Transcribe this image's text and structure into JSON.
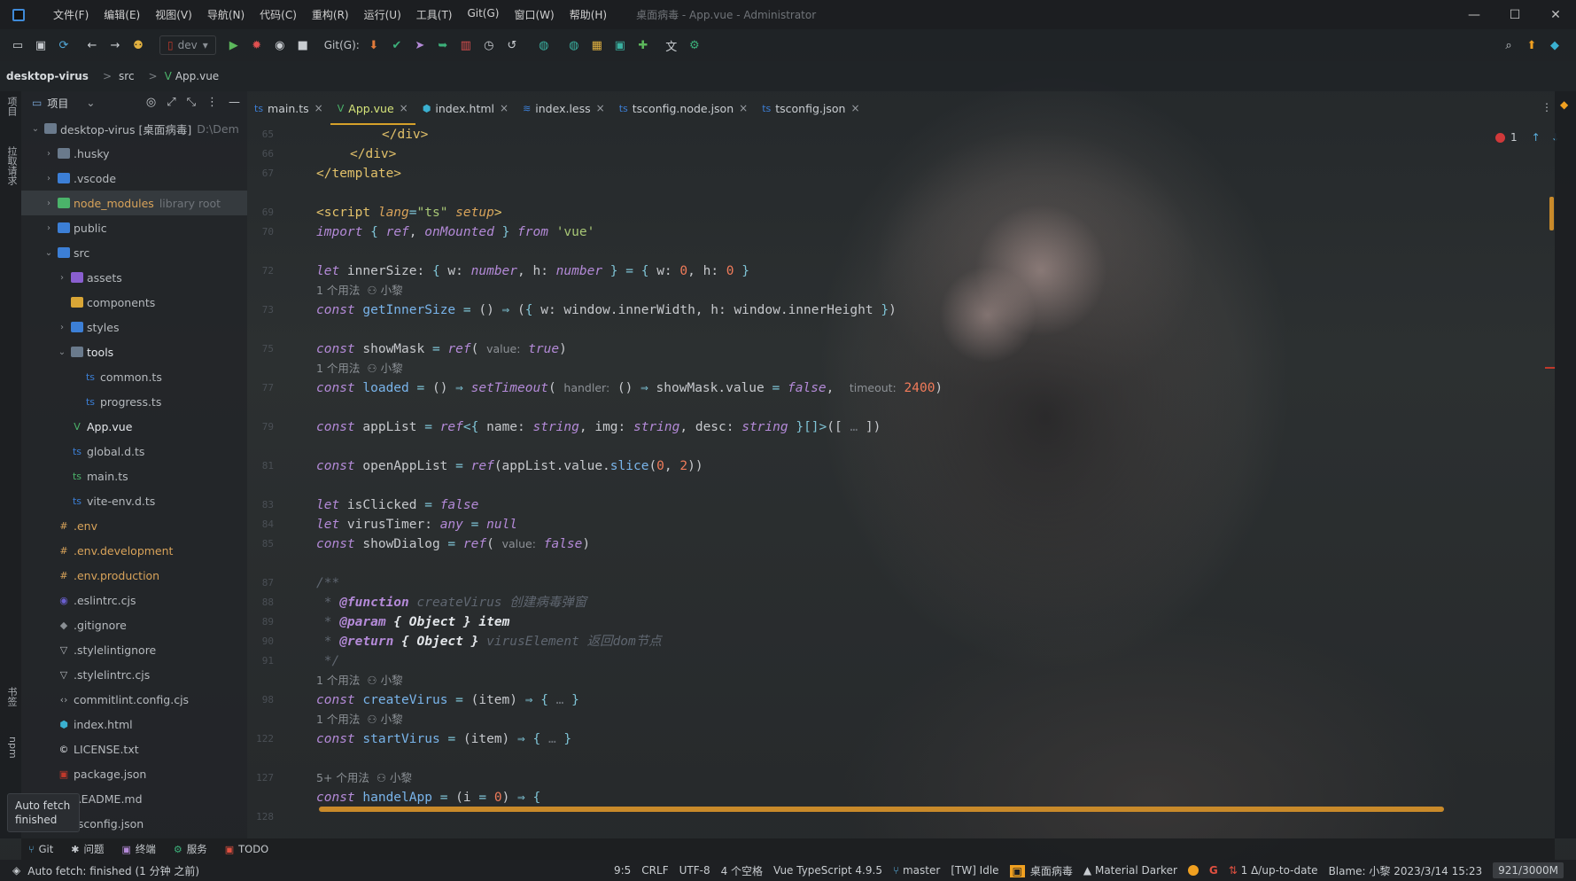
{
  "title_bar": {
    "menus": [
      "文件(F)",
      "编辑(E)",
      "视图(V)",
      "导航(N)",
      "代码(C)",
      "重构(R)",
      "运行(U)",
      "工具(T)",
      "Git(G)",
      "窗口(W)",
      "帮助(H)"
    ],
    "window_title": "桌面病毒 - App.vue - Administrator",
    "minimize": "—",
    "maximize": "☐",
    "close": "✕"
  },
  "toolbar": {
    "branch_config": "dev",
    "git_label": "Git(G):"
  },
  "breadcrumb": {
    "project": "desktop-virus",
    "folder": "src",
    "file": "App.vue",
    "sep": ">"
  },
  "left_stripe": {
    "project": "项目",
    "pull_requests": "拉取请求",
    "bookmarks": "书签",
    "npm": "npm"
  },
  "project_panel": {
    "title": "项目",
    "tree": [
      {
        "label": "desktop-virus [桌面病毒]",
        "hint": "D:\\Dem",
        "depth": 0,
        "chev": "⌄",
        "icon": "folder"
      },
      {
        "label": ".husky",
        "depth": 1,
        "chev": "›",
        "icon": "folder"
      },
      {
        "label": ".vscode",
        "depth": 1,
        "chev": "›",
        "icon": "blue"
      },
      {
        "label": "node_modules",
        "hint": "library root",
        "depth": 1,
        "chev": "›",
        "icon": "green",
        "orange": true,
        "selected": true
      },
      {
        "label": "public",
        "depth": 1,
        "chev": "›",
        "icon": "blue"
      },
      {
        "label": "src",
        "depth": 1,
        "chev": "⌄",
        "icon": "blue"
      },
      {
        "label": "assets",
        "depth": 2,
        "chev": "›",
        "icon": "purple"
      },
      {
        "label": "components",
        "depth": 2,
        "chev": "",
        "icon": "yellow"
      },
      {
        "label": "styles",
        "depth": 2,
        "chev": "›",
        "icon": "blue"
      },
      {
        "label": "tools",
        "depth": 2,
        "chev": "⌄",
        "icon": "folder",
        "white": true
      },
      {
        "label": "common.ts",
        "depth": 3,
        "chev": "",
        "icon": "ts"
      },
      {
        "label": "progress.ts",
        "depth": 3,
        "chev": "",
        "icon": "ts"
      },
      {
        "label": "App.vue",
        "depth": 2,
        "chev": "",
        "icon": "vue",
        "white": true
      },
      {
        "label": "global.d.ts",
        "depth": 2,
        "chev": "",
        "icon": "ts"
      },
      {
        "label": "main.ts",
        "depth": 2,
        "chev": "",
        "icon": "tsg"
      },
      {
        "label": "vite-env.d.ts",
        "depth": 2,
        "chev": "",
        "icon": "ts"
      },
      {
        "label": ".env",
        "depth": 1,
        "chev": "",
        "icon": "env",
        "orange": true
      },
      {
        "label": ".env.development",
        "depth": 1,
        "chev": "",
        "icon": "env",
        "orange": true
      },
      {
        "label": ".env.production",
        "depth": 1,
        "chev": "",
        "icon": "env",
        "orange": true
      },
      {
        "label": ".eslintrc.cjs",
        "depth": 1,
        "chev": "",
        "icon": "eslint"
      },
      {
        "label": ".gitignore",
        "depth": 1,
        "chev": "",
        "icon": "git"
      },
      {
        "label": ".stylelintignore",
        "depth": 1,
        "chev": "",
        "icon": "stylelint"
      },
      {
        "label": ".stylelintrc.cjs",
        "depth": 1,
        "chev": "",
        "icon": "stylelint"
      },
      {
        "label": "commitlint.config.cjs",
        "depth": 1,
        "chev": "",
        "icon": "js"
      },
      {
        "label": "index.html",
        "depth": 1,
        "chev": "",
        "icon": "html"
      },
      {
        "label": "LICENSE.txt",
        "depth": 1,
        "chev": "",
        "icon": "license"
      },
      {
        "label": "package.json",
        "depth": 1,
        "chev": "",
        "icon": "npm"
      },
      {
        "label": "README.md",
        "depth": 1,
        "chev": "",
        "icon": "md"
      },
      {
        "label": "tsconfig.json",
        "depth": 1,
        "chev": "",
        "icon": "ts"
      }
    ]
  },
  "tabs": [
    {
      "label": "main.ts",
      "icon": "ts",
      "active": false
    },
    {
      "label": "App.vue",
      "icon": "vue",
      "active": true
    },
    {
      "label": "index.html",
      "icon": "html",
      "active": false
    },
    {
      "label": "index.less",
      "icon": "less",
      "active": false
    },
    {
      "label": "tsconfig.node.json",
      "icon": "ts",
      "active": false
    },
    {
      "label": "tsconfig.json",
      "icon": "ts",
      "active": false
    }
  ],
  "inspection": {
    "count": "1"
  },
  "editor": {
    "line_numbers": [
      "65",
      "66",
      "67",
      "",
      "69",
      "70",
      "",
      "72",
      "",
      "73",
      "",
      "75",
      "",
      "77",
      "",
      "79",
      "",
      "81",
      "",
      "83",
      "84",
      "85",
      "",
      "87",
      "88",
      "89",
      "90",
      "91",
      "",
      "98",
      "",
      "122",
      "",
      "127",
      "",
      "128"
    ],
    "usage_hint": "1 个用法",
    "usage_hint_many": "5+ 个用法",
    "author": "小黎"
  },
  "toolwindows": [
    {
      "label": "Git",
      "icon": "git"
    },
    {
      "label": "问题",
      "icon": "problems"
    },
    {
      "label": "终端",
      "icon": "terminal"
    },
    {
      "label": "服务",
      "icon": "services"
    },
    {
      "label": "TODO",
      "icon": "todo"
    }
  ],
  "toast": {
    "line1": "Auto fetch",
    "line2": "finished"
  },
  "status_bar": {
    "left": "Auto fetch: finished (1 分钟 之前)",
    "position": "9:5",
    "line_sep": "CRLF",
    "encoding": "UTF-8",
    "indent": "4 个空格",
    "language": "Vue TypeScript 4.9.5",
    "branch": "master",
    "tw": "[TW] Idle",
    "project_name": "桌面病毒",
    "theme": "Material Darker",
    "vcs_status": "1 Δ/up-to-date",
    "blame": "Blame: 小黎 2023/3/14 15:23",
    "memory": "921/3000M"
  },
  "colors": {
    "accent": "#d6a12a",
    "error": "#d0393a",
    "keyword": "#b48ad8",
    "string": "#a8c776",
    "function": "#79b4ea",
    "number": "#f07b5a"
  }
}
